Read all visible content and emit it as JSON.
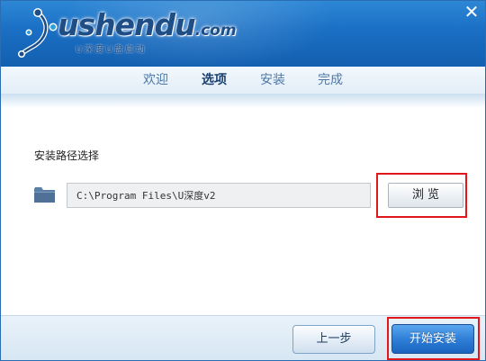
{
  "brand": {
    "name": "ushendu",
    "suffix": ".com",
    "tagline": "U深度U盘启动",
    "logo_icon": "ushendu-logo-icon"
  },
  "window": {
    "close_symbol": "✕",
    "close_icon": "close-icon"
  },
  "tabs": [
    {
      "label": "欢迎",
      "active": false
    },
    {
      "label": "选项",
      "active": true
    },
    {
      "label": "安装",
      "active": false
    },
    {
      "label": "完成",
      "active": false
    }
  ],
  "install_path": {
    "label": "安装路径选择",
    "value": "C:\\Program Files\\U深度v2",
    "folder_icon": "folder-icon",
    "browse_label": "浏览"
  },
  "footer": {
    "prev_label": "上一步",
    "start_label": "开始安装"
  },
  "colors": {
    "header_blue": "#1a6fc4",
    "highlight_red": "#e0181b",
    "primary_button": "#2f7fd8"
  }
}
